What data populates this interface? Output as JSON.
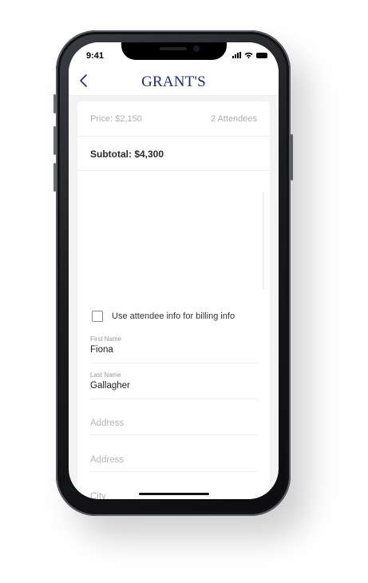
{
  "status_bar": {
    "time": "9:41",
    "icons": [
      "cellular-signal-icon",
      "wifi-icon",
      "battery-icon"
    ]
  },
  "header": {
    "back_icon": "chevron-left-icon",
    "logo": "GRANT'S"
  },
  "order": {
    "price": "Price: $2,150",
    "attendees": "2 Attendees",
    "subtotal": "Subtotal: $4,300"
  },
  "billing": {
    "use_attendee_checkbox_label": "Use attendee info for billing info",
    "use_attendee_checked": false,
    "first_name_label": "First Name",
    "first_name_value": "Fiona",
    "last_name_label": "Last Name",
    "last_name_value": "Gallagher",
    "address1_placeholder": "Address",
    "address2_placeholder": "Address",
    "city_placeholder": "City"
  },
  "colors": {
    "brand": "#1e2d6b",
    "background": "#f3f3f3",
    "card": "#ffffff"
  }
}
